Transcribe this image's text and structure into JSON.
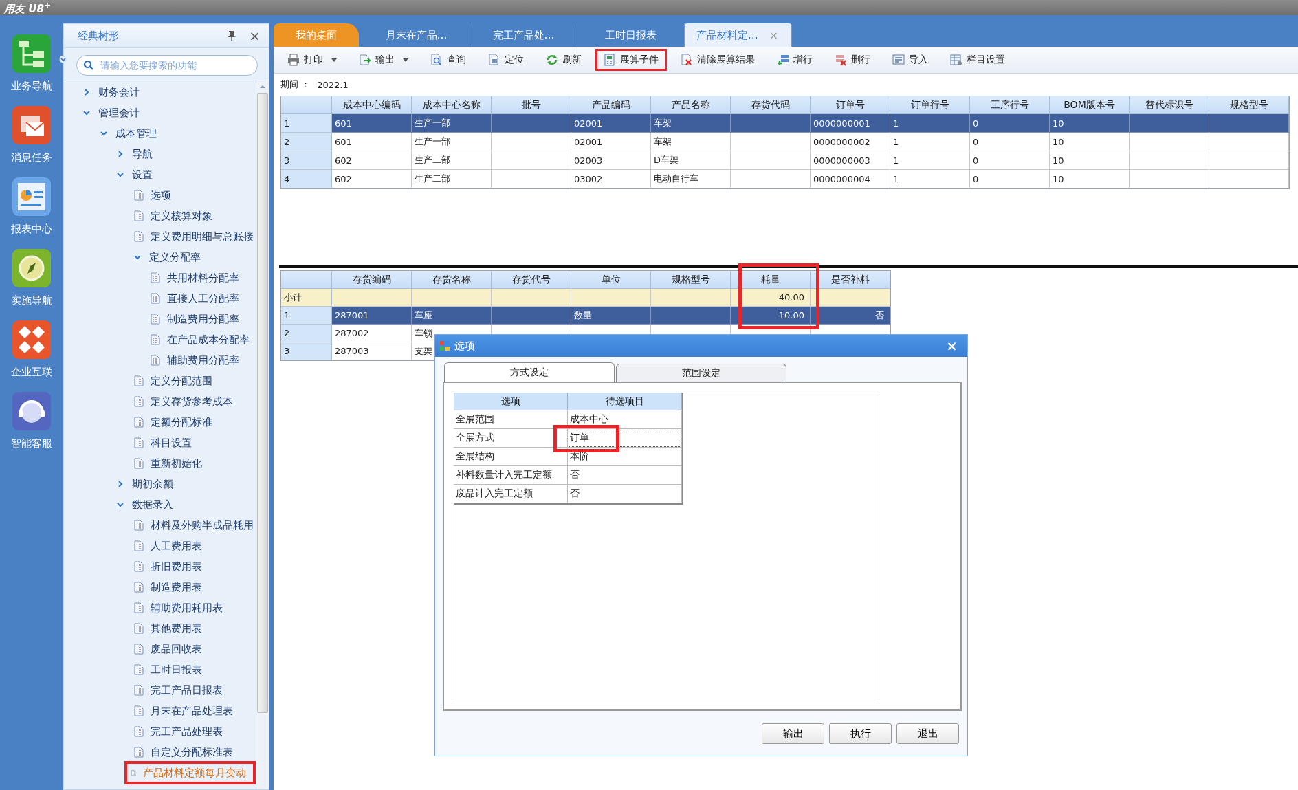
{
  "app_title": "用友 U8$^{+}$",
  "nav": [
    {
      "label": "业务导航"
    },
    {
      "label": "消息任务"
    },
    {
      "label": "报表中心"
    },
    {
      "label": "实施导航"
    },
    {
      "label": "企业互联"
    },
    {
      "label": "智能客服"
    }
  ],
  "sidebar": {
    "title": "经典树形",
    "close": "×",
    "search": {
      "placeholder": "请输入您要搜索的功能"
    },
    "tree": [
      {
        "label": "财务会计",
        "kind": "folder",
        "expanded": false,
        "selected": false
      },
      {
        "label": "管理会计",
        "kind": "folder",
        "expanded": true,
        "selected": false,
        "children": [
          {
            "label": "成本管理",
            "kind": "folder",
            "expanded": true,
            "selected": false,
            "children": [
              {
                "label": "导航",
                "kind": "folder",
                "expanded": false,
                "selected": false
              },
              {
                "label": "设置",
                "kind": "folder",
                "expanded": true,
                "selected": false,
                "children": [
                  {
                    "label": "选项",
                    "kind": "page",
                    "selected": false
                  },
                  {
                    "label": "定义核算对象",
                    "kind": "page",
                    "selected": false
                  },
                  {
                    "label": "定义费用明细与总账接",
                    "kind": "page",
                    "selected": false
                  },
                  {
                    "label": "定义分配率",
                    "kind": "folder",
                    "expanded": true,
                    "selected": false,
                    "children": [
                      {
                        "label": "共用材料分配率",
                        "kind": "page",
                        "selected": false
                      },
                      {
                        "label": "直接人工分配率",
                        "kind": "page",
                        "selected": false
                      },
                      {
                        "label": "制造费用分配率",
                        "kind": "page",
                        "selected": false
                      },
                      {
                        "label": "在产品成本分配率",
                        "kind": "page",
                        "selected": false
                      },
                      {
                        "label": "辅助费用分配率",
                        "kind": "page",
                        "selected": false
                      }
                    ]
                  },
                  {
                    "label": "定义分配范围",
                    "kind": "page",
                    "selected": false
                  },
                  {
                    "label": "定义存货参考成本",
                    "kind": "page",
                    "selected": false
                  },
                  {
                    "label": "定额分配标准",
                    "kind": "page",
                    "selected": false
                  },
                  {
                    "label": "科目设置",
                    "kind": "page",
                    "selected": false
                  },
                  {
                    "label": "重新初始化",
                    "kind": "page",
                    "selected": false
                  }
                ]
              },
              {
                "label": "期初余额",
                "kind": "folder",
                "expanded": false,
                "selected": false
              },
              {
                "label": "数据录入",
                "kind": "folder",
                "expanded": true,
                "selected": false,
                "children": [
                  {
                    "label": "材料及外购半成品耗用",
                    "kind": "page",
                    "selected": false
                  },
                  {
                    "label": "人工费用表",
                    "kind": "page",
                    "selected": false
                  },
                  {
                    "label": "折旧费用表",
                    "kind": "page",
                    "selected": false
                  },
                  {
                    "label": "制造费用表",
                    "kind": "page",
                    "selected": false
                  },
                  {
                    "label": "辅助费用耗用表",
                    "kind": "page",
                    "selected": false
                  },
                  {
                    "label": "其他费用表",
                    "kind": "page",
                    "selected": false
                  },
                  {
                    "label": "废品回收表",
                    "kind": "page",
                    "selected": false
                  },
                  {
                    "label": "工时日报表",
                    "kind": "page",
                    "selected": false
                  },
                  {
                    "label": "完工产品日报表",
                    "kind": "page",
                    "selected": false
                  },
                  {
                    "label": "月末在产品处理表",
                    "kind": "page",
                    "selected": false
                  },
                  {
                    "label": "完工产品处理表",
                    "kind": "page",
                    "selected": false
                  },
                  {
                    "label": "自定义分配标准表",
                    "kind": "page",
                    "selected": false
                  },
                  {
                    "label": "产品材料定额每月变动",
                    "kind": "page",
                    "selected": true,
                    "highlighted": true
                  }
                ]
              }
            ]
          }
        ]
      }
    ]
  },
  "tabs": [
    {
      "label": "我的桌面",
      "kind": "home",
      "selected": false
    },
    {
      "label": "月末在产品…",
      "kind": "page",
      "selected": false
    },
    {
      "label": "完工产品处…",
      "kind": "page",
      "selected": false
    },
    {
      "label": "工时日报表",
      "kind": "page",
      "selected": false
    },
    {
      "label": "产品材料定…",
      "kind": "page",
      "selected": true,
      "close": "×"
    }
  ],
  "toolbar": [
    {
      "label": "打印",
      "dropdown": true,
      "highlighted": false
    },
    {
      "label": "输出",
      "dropdown": true,
      "highlighted": false
    },
    {
      "label": "查询",
      "dropdown": false,
      "highlighted": false
    },
    {
      "label": "定位",
      "dropdown": false,
      "highlighted": false
    },
    {
      "label": "刷新",
      "dropdown": false,
      "highlighted": false
    },
    {
      "label": "展算子件",
      "dropdown": false,
      "highlighted": true
    },
    {
      "label": "清除展算结果",
      "dropdown": false,
      "highlighted": false
    },
    {
      "label": "增行",
      "dropdown": false,
      "highlighted": false
    },
    {
      "label": "删行",
      "dropdown": false,
      "highlighted": false
    },
    {
      "label": "导入",
      "dropdown": false,
      "highlighted": false
    },
    {
      "label": "栏目设置",
      "dropdown": false,
      "highlighted": false
    }
  ],
  "period": {
    "label": "期间 ：",
    "value": "2022.1"
  },
  "top_table": {
    "columns": [
      "成本中心编码",
      "成本中心名称",
      "批号",
      "产品编码",
      "产品名称",
      "存货代码",
      "订单号",
      "订单行号",
      "工序行号",
      "BOM版本号",
      "替代标识号",
      "规格型号"
    ],
    "rows": [
      {
        "number": "1",
        "selected": true,
        "cells": [
          "601",
          "生产一部",
          null,
          "02001",
          "车架",
          null,
          "0000000001",
          "1",
          "0",
          "10",
          null,
          null
        ]
      },
      {
        "number": "2",
        "selected": false,
        "cells": [
          "601",
          "生产一部",
          null,
          "02001",
          "车架",
          null,
          "0000000002",
          "1",
          "0",
          "10",
          null,
          null
        ]
      },
      {
        "number": "3",
        "selected": false,
        "cells": [
          "602",
          "生产二部",
          null,
          "02003",
          "D车架",
          null,
          "0000000003",
          "1",
          "0",
          "10",
          null,
          null
        ]
      },
      {
        "number": "4",
        "selected": false,
        "cells": [
          "602",
          "生产二部",
          null,
          "03002",
          "电动自行车",
          null,
          "0000000004",
          "1",
          "0",
          "10",
          null,
          null
        ]
      }
    ]
  },
  "bottom_table": {
    "columns": [
      {
        "label": "存货编码",
        "highlighted": false
      },
      {
        "label": "存货名称",
        "highlighted": false
      },
      {
        "label": "存货代号",
        "highlighted": false
      },
      {
        "label": "单位",
        "highlighted": false
      },
      {
        "label": "规格型号",
        "highlighted": false
      },
      {
        "label": "耗量",
        "highlighted": true
      },
      {
        "label": "是否补料",
        "highlighted": false
      }
    ],
    "subtotal": {
      "label": "小计",
      "cells": [
        null,
        null,
        null,
        null,
        null,
        "40.00",
        null
      ]
    },
    "rows": [
      {
        "number": "1",
        "selected": true,
        "cells": [
          "287001",
          "车座",
          null,
          "数量",
          null,
          "10.00",
          "否"
        ]
      },
      {
        "number": "2",
        "selected": false,
        "cells": [
          "287002",
          "车锁",
          null,
          null,
          null,
          null,
          null
        ]
      },
      {
        "number": "3",
        "selected": false,
        "cells": [
          "287003",
          "支架",
          null,
          null,
          null,
          null,
          null
        ]
      }
    ]
  },
  "dialog": {
    "title": "选项",
    "close": "×",
    "tabs": [
      {
        "label": "方式设定",
        "selected": true
      },
      {
        "label": "范围设定",
        "selected": false
      }
    ],
    "table": {
      "columns": [
        "选项",
        "待选项目"
      ],
      "rows": [
        {
          "option": "全展范围",
          "value": "成本中心",
          "focused": false
        },
        {
          "option": "全展方式",
          "value": "订单",
          "focused": true,
          "highlighted": true
        },
        {
          "option": "全展结构",
          "value": "本阶",
          "focused": false
        },
        {
          "option": "补料数量计入完工定额",
          "value": "否",
          "focused": false
        },
        {
          "option": "废品计入完工定额",
          "value": "否",
          "focused": false
        }
      ]
    },
    "buttons": [
      "输出",
      "执行",
      "退出"
    ]
  }
}
